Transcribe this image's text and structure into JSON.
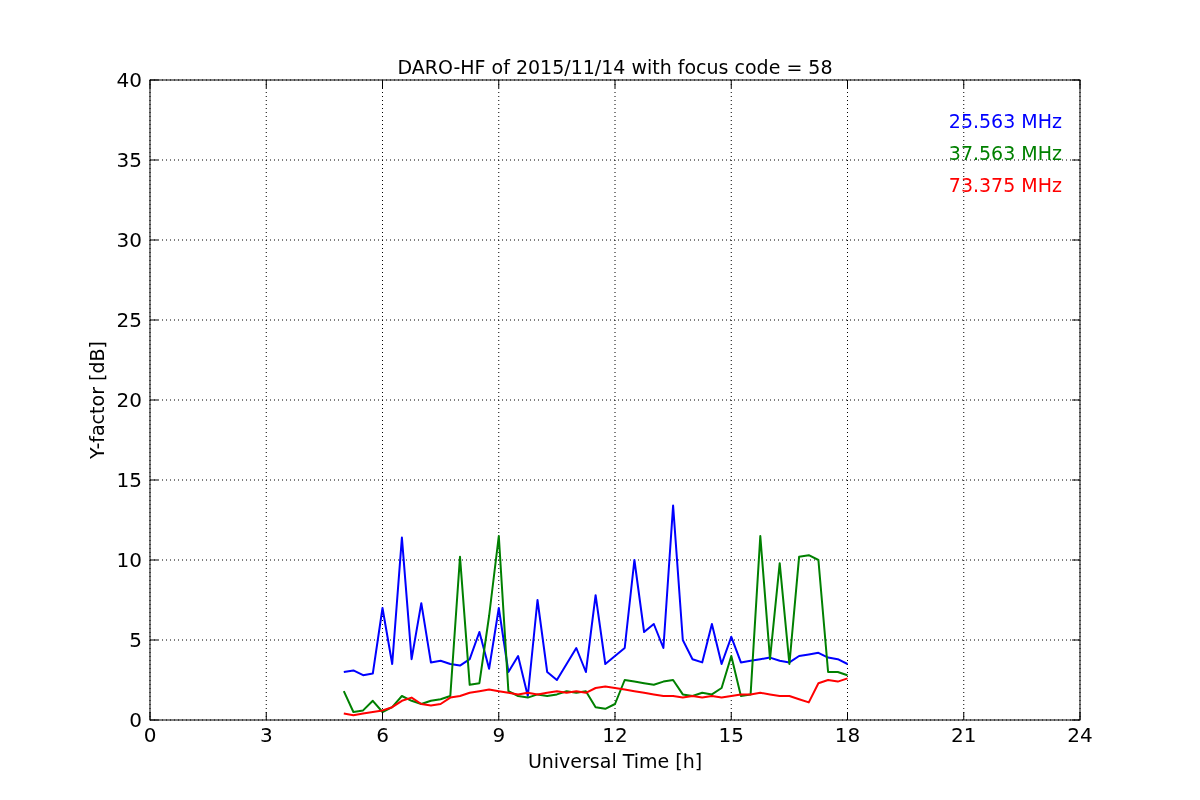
{
  "chart_data": {
    "type": "line",
    "title": "DARO-HF of 2015/11/14 with focus code = 58",
    "xlabel": "Universal Time [h]",
    "ylabel": "Y-factor [dB]",
    "x": [
      5,
      5.25,
      5.5,
      5.75,
      6,
      6.25,
      6.5,
      6.75,
      7,
      7.25,
      7.5,
      7.75,
      8,
      8.25,
      8.5,
      8.75,
      9,
      9.25,
      9.5,
      9.75,
      10,
      10.25,
      10.5,
      10.75,
      11,
      11.25,
      11.5,
      11.75,
      12,
      12.25,
      12.5,
      12.75,
      13,
      13.25,
      13.5,
      13.75,
      14,
      14.25,
      14.5,
      14.75,
      15,
      15.25,
      15.5,
      15.75,
      16,
      16.25,
      16.5,
      16.75,
      17,
      17.25,
      17.5,
      17.75,
      18
    ],
    "series": [
      {
        "name": "25.563 MHz",
        "color": "#0000ff",
        "values": [
          3.0,
          3.1,
          2.8,
          2.9,
          7.0,
          3.5,
          11.4,
          3.8,
          7.3,
          3.6,
          3.7,
          3.5,
          3.4,
          3.8,
          5.5,
          3.2,
          7.0,
          3.0,
          4.0,
          1.5,
          7.5,
          3.0,
          2.5,
          3.5,
          4.5,
          3.0,
          7.8,
          3.5,
          4.0,
          4.5,
          10.0,
          5.5,
          6.0,
          4.5,
          13.4,
          5.0,
          3.8,
          3.6,
          6.0,
          3.5,
          5.2,
          3.6,
          3.7,
          3.8,
          3.9,
          3.7,
          3.6,
          4.0,
          4.1,
          4.2,
          3.9,
          3.8,
          3.5
        ]
      },
      {
        "name": "37.563 MHz",
        "color": "#008000",
        "values": [
          1.8,
          0.5,
          0.6,
          1.2,
          0.5,
          0.8,
          1.5,
          1.2,
          1.0,
          1.2,
          1.3,
          1.5,
          10.2,
          2.2,
          2.3,
          6.5,
          11.5,
          1.8,
          1.5,
          1.4,
          1.6,
          1.5,
          1.6,
          1.8,
          1.7,
          1.8,
          0.8,
          0.7,
          1.0,
          2.5,
          2.4,
          2.3,
          2.2,
          2.4,
          2.5,
          1.6,
          1.5,
          1.7,
          1.6,
          2.0,
          4.0,
          1.5,
          1.6,
          11.5,
          3.8,
          9.8,
          3.5,
          10.2,
          10.3,
          10.0,
          3.0,
          3.0,
          2.8
        ]
      },
      {
        "name": "73.375 MHz",
        "color": "#ff0000",
        "values": [
          0.4,
          0.3,
          0.4,
          0.5,
          0.6,
          0.8,
          1.2,
          1.4,
          1.0,
          0.9,
          1.0,
          1.4,
          1.5,
          1.7,
          1.8,
          1.9,
          1.8,
          1.7,
          1.6,
          1.7,
          1.6,
          1.7,
          1.8,
          1.7,
          1.8,
          1.7,
          2.0,
          2.1,
          2.0,
          1.9,
          1.8,
          1.7,
          1.6,
          1.5,
          1.5,
          1.4,
          1.5,
          1.4,
          1.5,
          1.4,
          1.5,
          1.6,
          1.6,
          1.7,
          1.6,
          1.5,
          1.5,
          1.3,
          1.1,
          2.3,
          2.5,
          2.4,
          2.6
        ]
      }
    ],
    "grid": true,
    "xlim": [
      0,
      24
    ],
    "ylim": [
      0,
      40
    ],
    "xticks": [
      0,
      3,
      6,
      9,
      12,
      15,
      18,
      21,
      24
    ],
    "yticks": [
      0,
      5,
      10,
      15,
      20,
      25,
      30,
      35,
      40
    ]
  }
}
